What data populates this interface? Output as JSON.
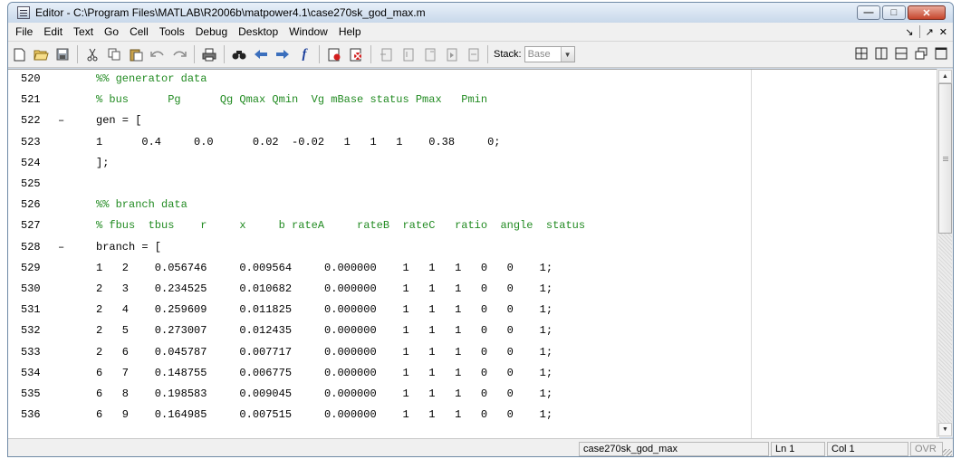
{
  "window": {
    "title": "Editor - C:\\Program Files\\MATLAB\\R2006b\\matpower4.1\\case270sk_god_max.m",
    "controls": {
      "minimize": "—",
      "maximize": "□",
      "close": "✕"
    }
  },
  "menu": {
    "items": [
      "File",
      "Edit",
      "Text",
      "Go",
      "Cell",
      "Tools",
      "Debug",
      "Desktop",
      "Window",
      "Help"
    ],
    "right_arrow": "↘",
    "right_undock": "↗",
    "right_close": "✕"
  },
  "toolbar": {
    "icons": [
      "new-file-icon",
      "open-folder-icon",
      "save-icon",
      "cut-icon",
      "copy-icon",
      "paste-icon",
      "undo-icon",
      "redo-icon",
      "print-icon",
      "find-icon",
      "back-icon",
      "forward-icon",
      "function-icon",
      "set-breakpoint-icon",
      "clear-breakpoint-icon",
      "step-icon",
      "step-in-icon",
      "step-out-icon",
      "continue-icon",
      "exit-debug-icon"
    ],
    "function_glyph": "f",
    "stack_label": "Stack:",
    "stack_value": "Base"
  },
  "editor": {
    "lines": [
      {
        "num": "520",
        "dash": "",
        "text": "%% generator data",
        "comment": true
      },
      {
        "num": "521",
        "dash": "",
        "text": "% bus      Pg      Qg Qmax Qmin  Vg mBase status Pmax   Pmin",
        "comment": true
      },
      {
        "num": "522",
        "dash": "–",
        "text": "gen = [",
        "comment": false
      },
      {
        "num": "523",
        "dash": "",
        "text": "1      0.4     0.0      0.02  -0.02   1   1   1    0.38     0;",
        "comment": false
      },
      {
        "num": "524",
        "dash": "",
        "text": "];",
        "comment": false
      },
      {
        "num": "525",
        "dash": "",
        "text": "",
        "comment": false
      },
      {
        "num": "526",
        "dash": "",
        "text": "%% branch data",
        "comment": true
      },
      {
        "num": "527",
        "dash": "",
        "text": "% fbus  tbus    r     x     b rateA     rateB  rateC   ratio  angle  status",
        "comment": true
      },
      {
        "num": "528",
        "dash": "–",
        "text": "branch = [",
        "comment": false
      },
      {
        "num": "529",
        "dash": "",
        "text": "1   2    0.056746     0.009564     0.000000    1   1   1   0   0    1;",
        "comment": false
      },
      {
        "num": "530",
        "dash": "",
        "text": "2   3    0.234525     0.010682     0.000000    1   1   1   0   0    1;",
        "comment": false
      },
      {
        "num": "531",
        "dash": "",
        "text": "2   4    0.259609     0.011825     0.000000    1   1   1   0   0    1;",
        "comment": false
      },
      {
        "num": "532",
        "dash": "",
        "text": "2   5    0.273007     0.012435     0.000000    1   1   1   0   0    1;",
        "comment": false
      },
      {
        "num": "533",
        "dash": "",
        "text": "2   6    0.045787     0.007717     0.000000    1   1   1   0   0    1;",
        "comment": false
      },
      {
        "num": "534",
        "dash": "",
        "text": "6   7    0.148755     0.006775     0.000000    1   1   1   0   0    1;",
        "comment": false
      },
      {
        "num": "535",
        "dash": "",
        "text": "6   8    0.198583     0.009045     0.000000    1   1   1   0   0    1;",
        "comment": false
      },
      {
        "num": "536",
        "dash": "",
        "text": "6   9    0.164985     0.007515     0.000000    1   1   1   0   0    1;",
        "comment": false
      }
    ]
  },
  "status": {
    "filename": "case270sk_god_max",
    "ln": "Ln  1",
    "col": "Col  1",
    "ovr": "OVR"
  },
  "colors": {
    "comment": "#228b22",
    "title_gradient_top": "#e8f0f9",
    "close_button": "#c5452c"
  }
}
